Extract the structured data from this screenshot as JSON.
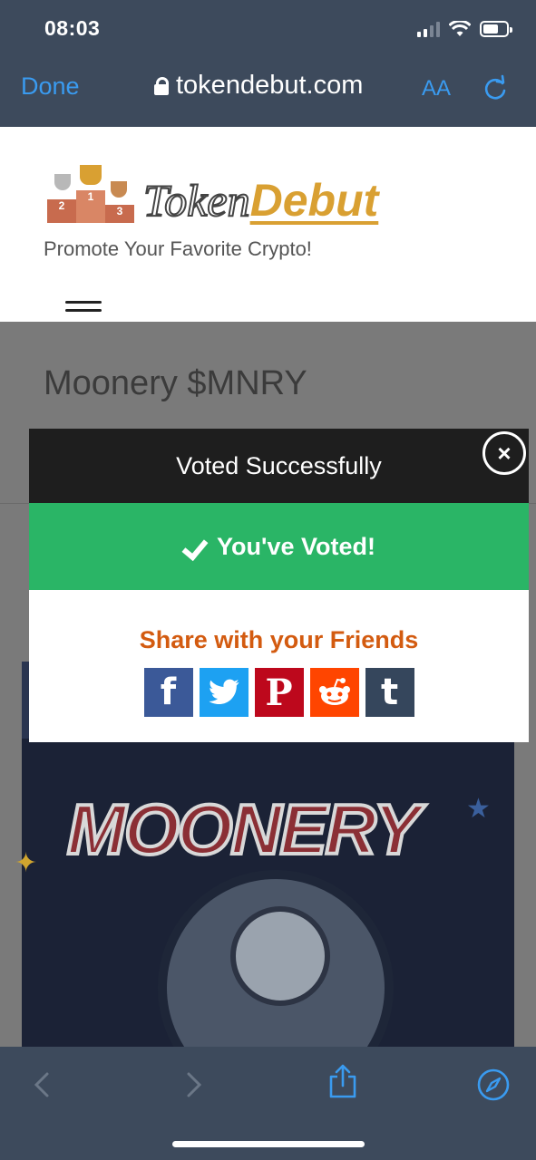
{
  "status_bar": {
    "time": "08:03"
  },
  "browser": {
    "done_label": "Done",
    "url": "tokendebut.com",
    "text_size_label": "AA",
    "icons": [
      "lock-icon",
      "reload-icon",
      "back-icon",
      "forward-icon",
      "share-icon",
      "compass-icon"
    ]
  },
  "site": {
    "logo_part1": "Token",
    "logo_part2": "Debut",
    "podium_numbers": [
      "2",
      "1",
      "3"
    ],
    "tagline": "Promote Your Favorite Crypto!"
  },
  "page": {
    "title": "Moonery $MNRY",
    "mascot_text": "MOONERY"
  },
  "modal": {
    "header": "Voted Successfully",
    "voted_label": "You've Voted!",
    "share_title": "Share with your Friends",
    "close_symbol": "×",
    "share_buttons": [
      {
        "label": "f",
        "color": "#3b5998",
        "icon": "facebook-icon"
      },
      {
        "label": "🐦",
        "color": "#1da1f2",
        "icon": "twitter-icon"
      },
      {
        "label": "P",
        "color": "#bd081c",
        "icon": "pinterest-icon"
      },
      {
        "label": "👽",
        "color": "#ff4500",
        "icon": "reddit-icon"
      },
      {
        "label": "t",
        "color": "#35465c",
        "icon": "tumblr-icon"
      }
    ]
  },
  "colors": {
    "chrome": "#3d4a5c",
    "accent_blue": "#3a9bf0",
    "voted_green": "#2ab566",
    "share_orange": "#d35b10",
    "logo_gold": "#d9a032"
  }
}
